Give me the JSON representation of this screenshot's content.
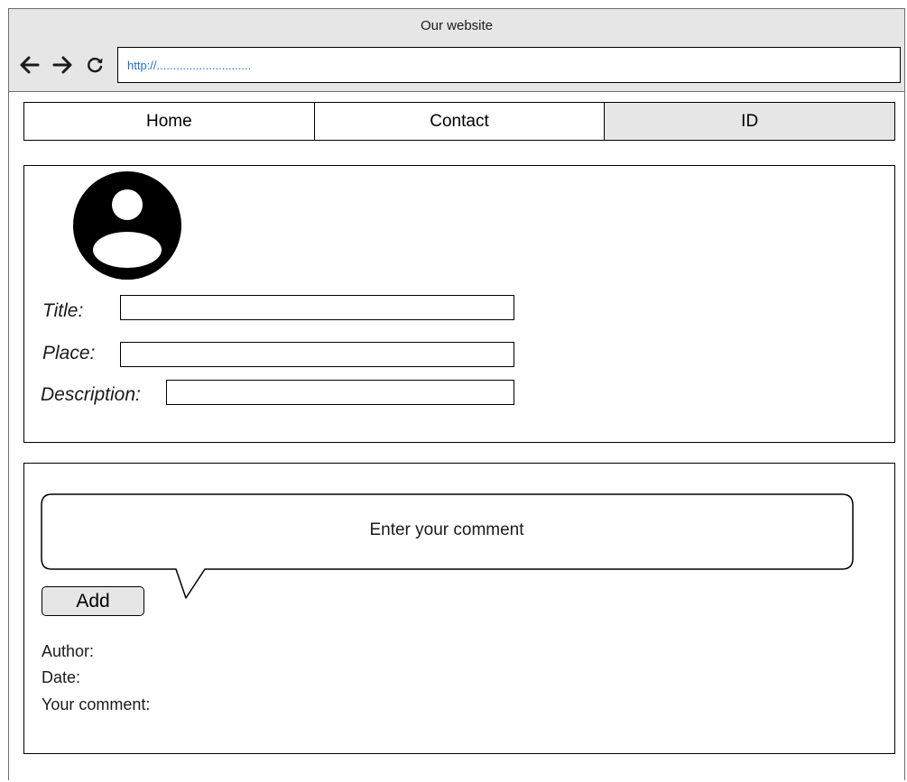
{
  "browser": {
    "title": "Our website",
    "address": "http://.............................",
    "icons": {
      "back": "arrow-left-icon",
      "forward": "arrow-right-icon",
      "reload": "reload-icon"
    }
  },
  "nav": {
    "tabs": [
      {
        "label": "Home",
        "active": false
      },
      {
        "label": "Contact",
        "active": false
      },
      {
        "label": "ID",
        "active": true
      }
    ]
  },
  "profile": {
    "avatar_icon": "user-avatar-icon",
    "fields": [
      {
        "label": "Title:",
        "value": ""
      },
      {
        "label": "Place:",
        "value": ""
      },
      {
        "label": "Description:",
        "value": ""
      }
    ]
  },
  "comments": {
    "input_placeholder": "Enter your comment",
    "add_label": "Add",
    "author_label": "Author:",
    "date_label": "Date:",
    "comment_label": "Your comment:"
  },
  "colors": {
    "chrome_bg": "#e6e6e6",
    "active_tab_bg": "#e6e6e6",
    "address_text": "#1f6fd1",
    "border": "#000000"
  }
}
